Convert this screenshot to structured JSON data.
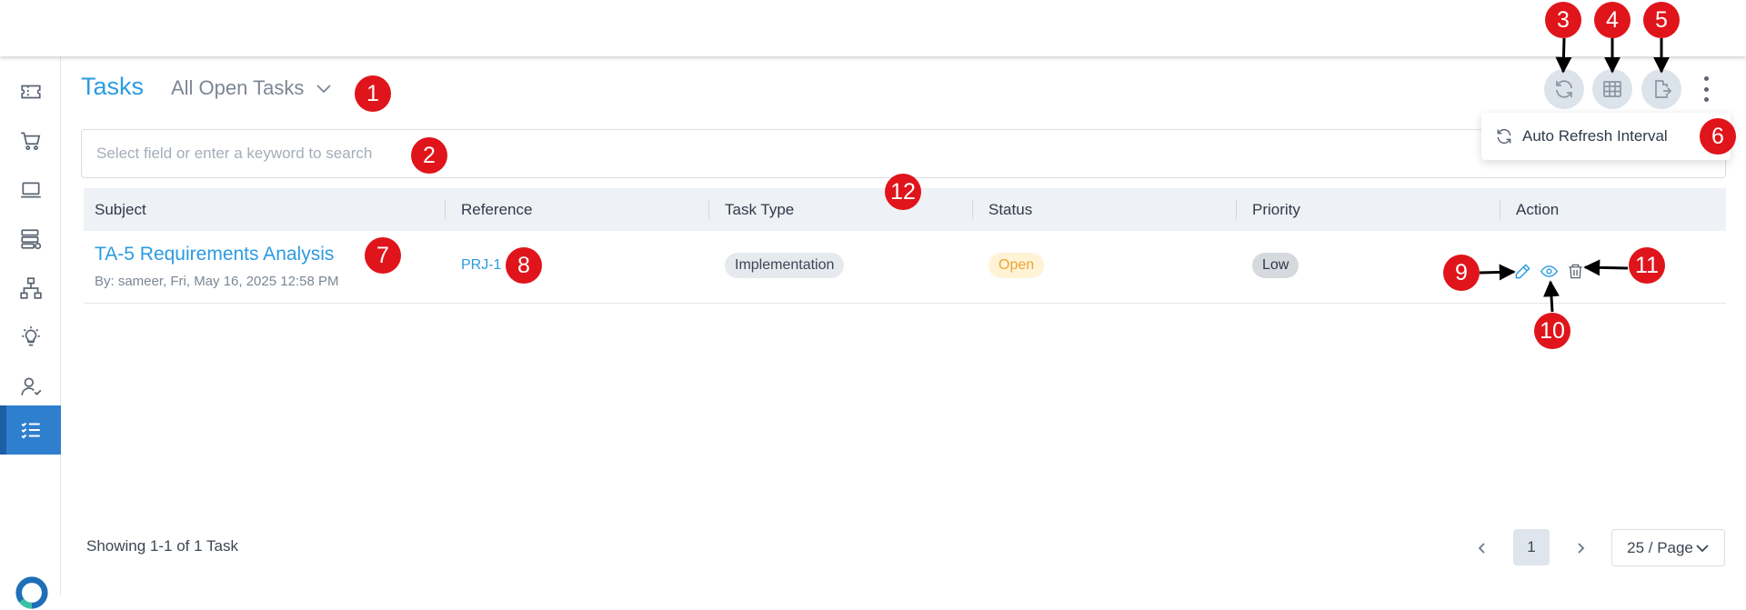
{
  "header": {
    "title": "Tasks",
    "view_selector": "All Open Tasks"
  },
  "sidebar": {
    "items": [
      {
        "icon": "ticket-icon",
        "active": false
      },
      {
        "icon": "cart-icon",
        "active": false
      },
      {
        "icon": "laptop-icon",
        "active": false
      },
      {
        "icon": "server-settings-icon",
        "active": false
      },
      {
        "icon": "hierarchy-icon",
        "active": false
      },
      {
        "icon": "lightbulb-icon",
        "active": false
      },
      {
        "icon": "user-check-icon",
        "active": false
      },
      {
        "icon": "task-list-icon",
        "active": true
      }
    ]
  },
  "toolbar": {
    "buttons": [
      "refresh-icon",
      "table-grid-icon",
      "export-icon",
      "more-vertical-icon"
    ],
    "popup_label": "Auto Refresh Interval"
  },
  "search": {
    "placeholder": "Select field or enter a keyword to search"
  },
  "table": {
    "columns": [
      "Subject",
      "Reference",
      "Task Type",
      "Status",
      "Priority",
      "Action"
    ],
    "rows": [
      {
        "subject": "TA-5 Requirements Analysis",
        "byline": "By: sameer, Fri, May 16, 2025 12:58 PM",
        "reference": "PRJ-1",
        "task_type": "Implementation",
        "status": "Open",
        "priority": "Low",
        "actions": [
          "edit-icon",
          "view-icon",
          "delete-icon"
        ]
      }
    ]
  },
  "footer": {
    "summary": "Showing 1-1 of 1 Task",
    "current_page": "1",
    "page_size": "25 / Page"
  },
  "callouts": [
    "1",
    "2",
    "3",
    "4",
    "5",
    "6",
    "7",
    "8",
    "9",
    "10",
    "11",
    "12"
  ],
  "colors": {
    "accent": "#2b9be0",
    "sidebar_active": "#2f7fcf",
    "callout": "#e0141b",
    "status_open": "#e8a53a"
  }
}
